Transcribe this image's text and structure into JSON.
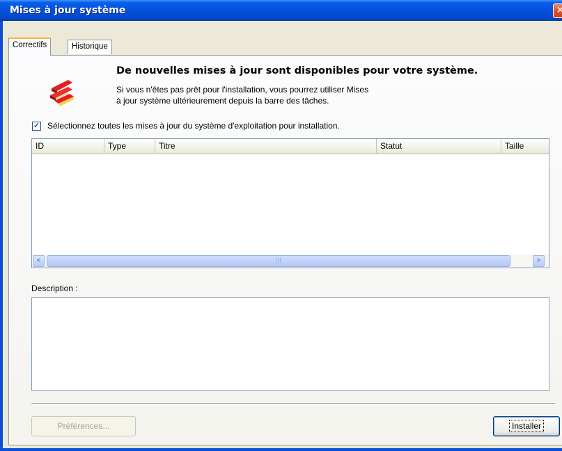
{
  "window": {
    "title": "Mises à jour système",
    "close_symbol": "✕"
  },
  "tabs": [
    {
      "label": "Correctifs",
      "active": true
    },
    {
      "label": "Historique",
      "active": false
    }
  ],
  "banner": {
    "icon": "update-available-icon",
    "headline": "De nouvelles mises à jour sont disponibles pour votre système.",
    "message_line1": "Si vous n'êtes pas prêt pour l'installation, vous pourrez utiliser Mises",
    "message_line2": "à jour système ultérieurement depuis la barre des tâches."
  },
  "select_all": {
    "checked": true,
    "check_mark": "✓",
    "label": "Sélectionnez toutes les mises à jour du système d'exploitation pour installation."
  },
  "updates_table": {
    "columns": [
      "ID",
      "Type",
      "Titre",
      "Statut",
      "Taille"
    ],
    "rows": []
  },
  "scrollbar": {
    "left_arrow": "<",
    "right_arrow": ">",
    "thumb_grip": "|||"
  },
  "description": {
    "label": "Description :",
    "text": ""
  },
  "buttons": {
    "preferences_label": "Préférences...",
    "preferences_enabled": false,
    "install_label": "Installer"
  },
  "colors": {
    "titlebar": "#0554e0",
    "window_bg": "#ece9d8",
    "active_tab_accent": "#f7b640",
    "icon_red": "#e02020",
    "icon_yellow": "#f8d04a"
  }
}
